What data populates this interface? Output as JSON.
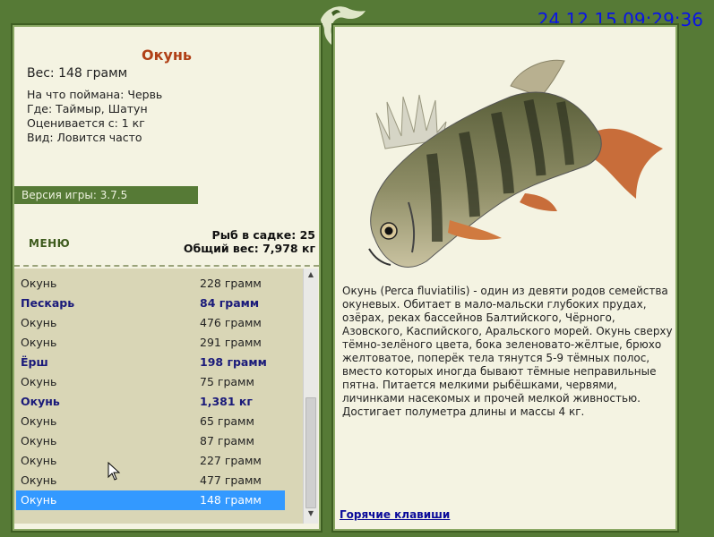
{
  "timestamp": "24.12.15 09:29:36",
  "fish": {
    "name": "Окунь",
    "weight": "Вес: 148 грамм",
    "bait": "На что поймана: Червь",
    "location": "Где: Таймыр, Шатун",
    "value": "Оценивается с: 1 кг",
    "species": "Вид: Ловится часто"
  },
  "version": "Версия игры: 3.7.5",
  "menu_label": "МЕНЮ",
  "stats": {
    "fish_count": "Рыб в садке: 25",
    "total_weight": "Общий вес: 7,978 кг"
  },
  "catch_list": [
    {
      "name": "Окунь",
      "weight": "228 грамм",
      "bold": false,
      "selected": false
    },
    {
      "name": "Пескарь",
      "weight": "84 грамм",
      "bold": true,
      "selected": false
    },
    {
      "name": "Окунь",
      "weight": "476 грамм",
      "bold": false,
      "selected": false
    },
    {
      "name": "Окунь",
      "weight": "291 грамм",
      "bold": false,
      "selected": false
    },
    {
      "name": "Ёрш",
      "weight": "198 грамм",
      "bold": true,
      "selected": false
    },
    {
      "name": "Окунь",
      "weight": "75 грамм",
      "bold": false,
      "selected": false
    },
    {
      "name": "Окунь",
      "weight": "1,381 кг",
      "bold": true,
      "selected": false
    },
    {
      "name": "Окунь",
      "weight": "65 грамм",
      "bold": false,
      "selected": false
    },
    {
      "name": "Окунь",
      "weight": "87 грамм",
      "bold": false,
      "selected": false
    },
    {
      "name": "Окунь",
      "weight": "227 грамм",
      "bold": false,
      "selected": false
    },
    {
      "name": "Окунь",
      "weight": "477 грамм",
      "bold": false,
      "selected": false
    },
    {
      "name": "Окунь",
      "weight": "148 грамм",
      "bold": false,
      "selected": true
    }
  ],
  "description": "Окунь (Perca fluviatilis) - один из девяти родов семейства окуневых. Обитает в мало-мальски глубоких прудах, озёрах, реках бассейнов Балтийского, Чёрного, Азовского, Каспийского, Аральского морей. Окунь сверху тёмно-зелёного цвета, бока зеленовато-жёлтые, брюхо желтоватое, поперёк тела тянутся 5-9 тёмных полос, вместо которых иногда бывают тёмные неправильные пятна. Питается мелкими рыбёшками, червями, личинками насекомых и прочей мелкой живностью. Достигает полуметра длины и массы 4 кг.",
  "hotkeys_label": "Горячие клавиши",
  "colors": {
    "frame": "#567a36",
    "panel": "#f4f3e2",
    "title": "#b04016",
    "timestamp": "#0a14e6",
    "list_bg": "#d9d6b6",
    "selected": "#3399ff",
    "bold_text": "#1a1a7a"
  },
  "icons": [
    "dragon-logo-icon",
    "scroll-up-icon",
    "scroll-down-icon",
    "mouse-cursor-icon"
  ]
}
